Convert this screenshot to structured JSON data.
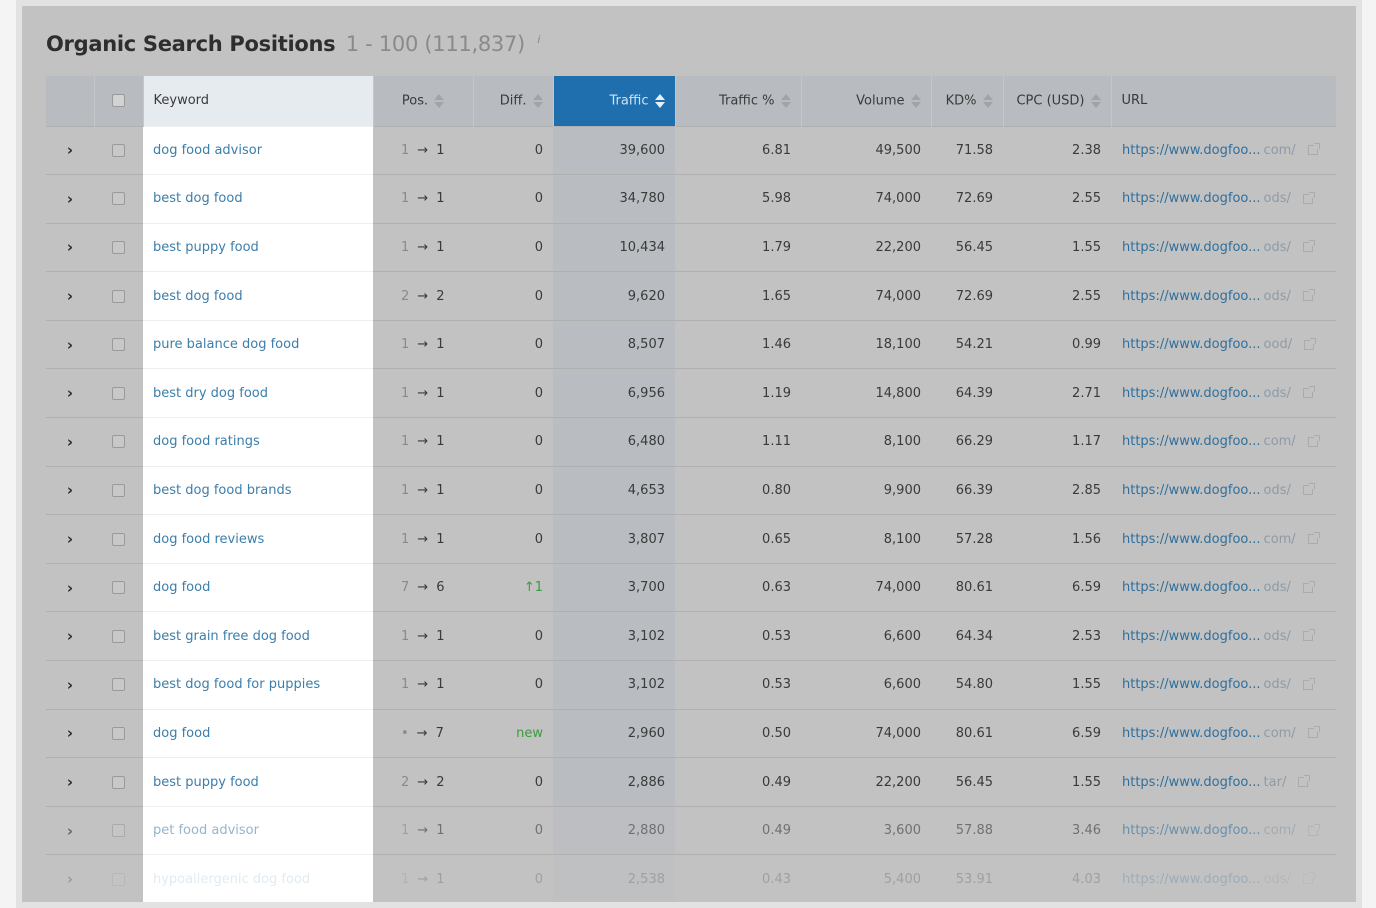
{
  "header": {
    "title": "Organic Search Positions",
    "range": "1 - 100 (111,837)",
    "info_icon": "i"
  },
  "columns": {
    "keyword": "Keyword",
    "pos": "Pos.",
    "diff": "Diff.",
    "traffic": "Traffic",
    "traffic_pct": "Traffic %",
    "volume": "Volume",
    "kd": "KD%",
    "cpc": "CPC (USD)",
    "url": "URL"
  },
  "colors": {
    "accent": "#1f6fae",
    "link": "#3c7eaa",
    "positive": "#3e9a3e"
  },
  "rows": [
    {
      "keyword": "dog food advisor",
      "pos_prev": "1",
      "pos_cur": "1",
      "diff": "0",
      "traffic": "39,600",
      "traffic_pct": "6.81",
      "volume": "49,500",
      "kd": "71.58",
      "cpc": "2.38",
      "url_main": "https://www.dogfoo...",
      "url_tail": "com/"
    },
    {
      "keyword": "best dog food",
      "pos_prev": "1",
      "pos_cur": "1",
      "diff": "0",
      "traffic": "34,780",
      "traffic_pct": "5.98",
      "volume": "74,000",
      "kd": "72.69",
      "cpc": "2.55",
      "url_main": "https://www.dogfoo...",
      "url_tail": "ods/"
    },
    {
      "keyword": "best puppy food",
      "pos_prev": "1",
      "pos_cur": "1",
      "diff": "0",
      "traffic": "10,434",
      "traffic_pct": "1.79",
      "volume": "22,200",
      "kd": "56.45",
      "cpc": "1.55",
      "url_main": "https://www.dogfoo...",
      "url_tail": "ods/"
    },
    {
      "keyword": "best dog food",
      "pos_prev": "2",
      "pos_cur": "2",
      "diff": "0",
      "traffic": "9,620",
      "traffic_pct": "1.65",
      "volume": "74,000",
      "kd": "72.69",
      "cpc": "2.55",
      "url_main": "https://www.dogfoo...",
      "url_tail": "ods/"
    },
    {
      "keyword": "pure balance dog food",
      "pos_prev": "1",
      "pos_cur": "1",
      "diff": "0",
      "traffic": "8,507",
      "traffic_pct": "1.46",
      "volume": "18,100",
      "kd": "54.21",
      "cpc": "0.99",
      "url_main": "https://www.dogfoo...",
      "url_tail": "ood/"
    },
    {
      "keyword": "best dry dog food",
      "pos_prev": "1",
      "pos_cur": "1",
      "diff": "0",
      "traffic": "6,956",
      "traffic_pct": "1.19",
      "volume": "14,800",
      "kd": "64.39",
      "cpc": "2.71",
      "url_main": "https://www.dogfoo...",
      "url_tail": "ods/"
    },
    {
      "keyword": "dog food ratings",
      "pos_prev": "1",
      "pos_cur": "1",
      "diff": "0",
      "traffic": "6,480",
      "traffic_pct": "1.11",
      "volume": "8,100",
      "kd": "66.29",
      "cpc": "1.17",
      "url_main": "https://www.dogfoo...",
      "url_tail": "com/"
    },
    {
      "keyword": "best dog food brands",
      "pos_prev": "1",
      "pos_cur": "1",
      "diff": "0",
      "traffic": "4,653",
      "traffic_pct": "0.80",
      "volume": "9,900",
      "kd": "66.39",
      "cpc": "2.85",
      "url_main": "https://www.dogfoo...",
      "url_tail": "ods/"
    },
    {
      "keyword": "dog food reviews",
      "pos_prev": "1",
      "pos_cur": "1",
      "diff": "0",
      "traffic": "3,807",
      "traffic_pct": "0.65",
      "volume": "8,100",
      "kd": "57.28",
      "cpc": "1.56",
      "url_main": "https://www.dogfoo...",
      "url_tail": "com/"
    },
    {
      "keyword": "dog food",
      "pos_prev": "7",
      "pos_cur": "6",
      "diff": "↑1",
      "diff_type": "up",
      "traffic": "3,700",
      "traffic_pct": "0.63",
      "volume": "74,000",
      "kd": "80.61",
      "cpc": "6.59",
      "url_main": "https://www.dogfoo...",
      "url_tail": "ods/"
    },
    {
      "keyword": "best grain free dog food",
      "pos_prev": "1",
      "pos_cur": "1",
      "diff": "0",
      "traffic": "3,102",
      "traffic_pct": "0.53",
      "volume": "6,600",
      "kd": "64.34",
      "cpc": "2.53",
      "url_main": "https://www.dogfoo...",
      "url_tail": "ods/"
    },
    {
      "keyword": "best dog food for puppies",
      "pos_prev": "1",
      "pos_cur": "1",
      "diff": "0",
      "traffic": "3,102",
      "traffic_pct": "0.53",
      "volume": "6,600",
      "kd": "54.80",
      "cpc": "1.55",
      "url_main": "https://www.dogfoo...",
      "url_tail": "ods/"
    },
    {
      "keyword": "dog food",
      "pos_prev": "•",
      "pos_cur": "7",
      "diff": "new",
      "diff_type": "new",
      "traffic": "2,960",
      "traffic_pct": "0.50",
      "volume": "74,000",
      "kd": "80.61",
      "cpc": "6.59",
      "url_main": "https://www.dogfoo...",
      "url_tail": "com/"
    },
    {
      "keyword": "best puppy food",
      "pos_prev": "2",
      "pos_cur": "2",
      "diff": "0",
      "traffic": "2,886",
      "traffic_pct": "0.49",
      "volume": "22,200",
      "kd": "56.45",
      "cpc": "1.55",
      "url_main": "https://www.dogfoo...",
      "url_tail": "tar/"
    },
    {
      "keyword": "pet food advisor",
      "pos_prev": "1",
      "pos_cur": "1",
      "diff": "0",
      "traffic": "2,880",
      "traffic_pct": "0.49",
      "volume": "3,600",
      "kd": "57.88",
      "cpc": "3.46",
      "url_main": "https://www.dogfoo...",
      "url_tail": "com/",
      "fade": 1
    },
    {
      "keyword": "hypoallergenic dog food",
      "pos_prev": "1",
      "pos_cur": "1",
      "diff": "0",
      "traffic": "2,538",
      "traffic_pct": "0.43",
      "volume": "5,400",
      "kd": "53.91",
      "cpc": "4.03",
      "url_main": "https://www.dogfoo...",
      "url_tail": "ods/",
      "fade": 2
    }
  ]
}
